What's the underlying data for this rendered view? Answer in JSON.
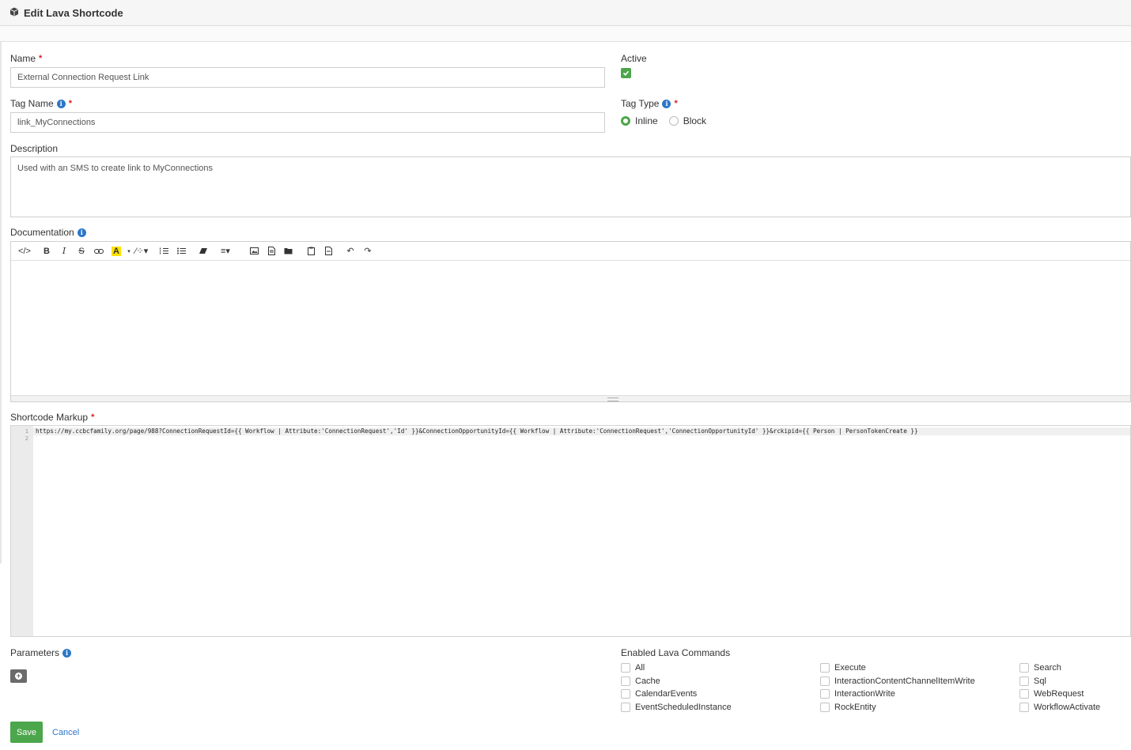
{
  "header": {
    "title": "Edit Lava Shortcode",
    "icon": "cube-icon"
  },
  "form": {
    "name_label": "Name",
    "name_value": "External Connection Request Link",
    "active_label": "Active",
    "active_checked": true,
    "tag_name_label": "Tag Name",
    "tag_name_value": "link_MyConnections",
    "tag_type_label": "Tag Type",
    "tag_type_options": [
      "Inline",
      "Block"
    ],
    "tag_type_selected": "Inline",
    "description_label": "Description",
    "description_value": "Used with an SMS to create link to MyConnections",
    "documentation_label": "Documentation",
    "shortcode_markup_label": "Shortcode Markup",
    "markup_lines": [
      "https://my.ccbcfamily.org/page/988?ConnectionRequestId={{ Workflow | Attribute:'ConnectionRequest','Id' }}&ConnectionOpportunityId={{ Workflow | Attribute:'ConnectionRequest','ConnectionOpportunityId' }}&rckipid={{ Person | PersonTokenCreate }}",
      ""
    ],
    "line_numbers": [
      "1",
      "2"
    ],
    "parameters_label": "Parameters",
    "enabled_commands_label": "Enabled Lava Commands",
    "commands_col1": [
      "All",
      "Cache",
      "CalendarEvents",
      "EventScheduledInstance"
    ],
    "commands_col2": [
      "Execute",
      "InteractionContentChannelItemWrite",
      "InteractionWrite",
      "RockEntity"
    ],
    "commands_col3": [
      "Search",
      "Sql",
      "WebRequest",
      "WorkflowActivate"
    ]
  },
  "actions": {
    "save_label": "Save",
    "cancel_label": "Cancel"
  },
  "colors": {
    "accent_green": "#4ca64c",
    "link_blue": "#2c77c9",
    "required_red": "#e01d1d"
  }
}
